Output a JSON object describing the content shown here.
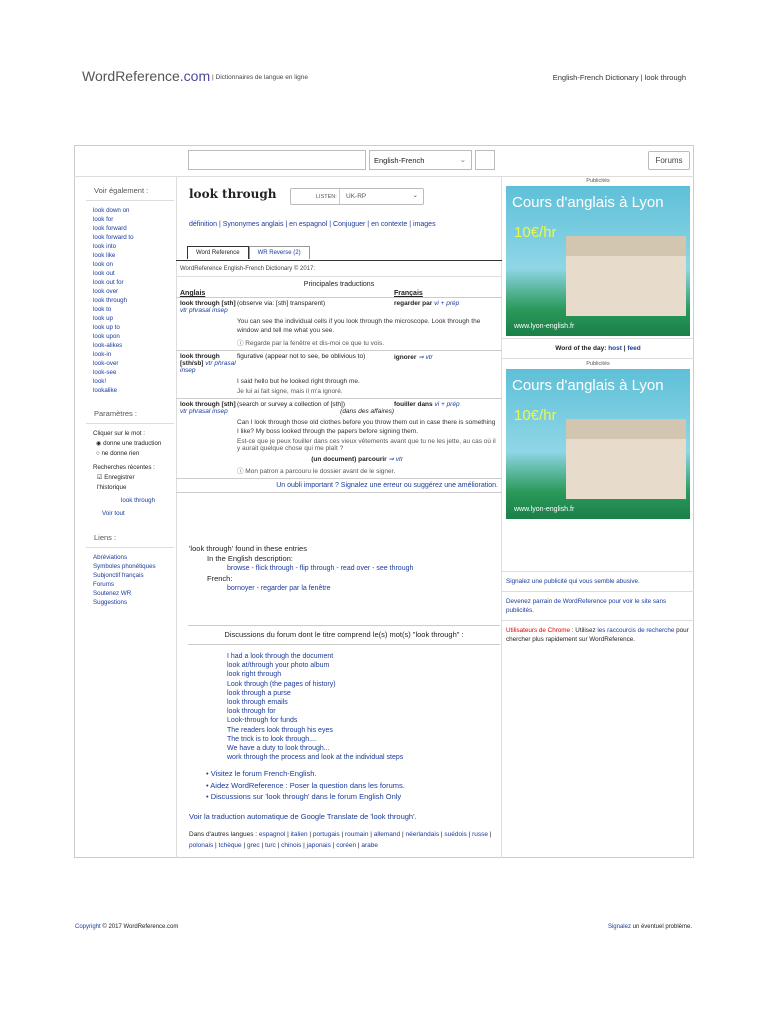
{
  "header": {
    "logo": "WordReference",
    "logo_com": ".com",
    "tagline": "| Dictionnaires de langue en ligne",
    "breadcrumb": "English-French Dictionary | look through"
  },
  "search": {
    "value": "",
    "lang": "English-French",
    "forums": "Forums"
  },
  "sidebar": {
    "see_also_title": "Voir également :",
    "see_also": [
      "look down on",
      "look for",
      "look forward",
      "look forward to",
      "look into",
      "look like",
      "look on",
      "look out",
      "look out for",
      "look over",
      "look through",
      "look to",
      "look up",
      "look up to",
      "look upon",
      "look-alikes",
      "look-in",
      "look-over",
      "look-see",
      "look!",
      "lookalike"
    ],
    "params_title": "Paramètres :",
    "click_label": "Cliquer sur le mot :",
    "opt1": "donne une traduction",
    "opt2": "ne donne rien",
    "recent_label": "Recherches récentes :",
    "save_history": "Enregistrer l'historique",
    "recent": "look through",
    "see_all": "Voir tout",
    "links_title": "Liens :",
    "links": [
      "Abréviations",
      "Symboles phonétiques",
      "Subjonctif français",
      "Forums",
      "Soutenez WR",
      "Suggestions"
    ]
  },
  "entry": {
    "title": "look through",
    "listen_label": "LISTEN:",
    "accent": "UK-RP",
    "links": [
      {
        "t": "définition"
      },
      {
        "t": "Synonymes anglais"
      },
      {
        "t": "en espagnol"
      },
      {
        "t": "Conjuguer"
      },
      {
        "t": "en contexte"
      },
      {
        "t": "images"
      }
    ],
    "tabs": [
      "Word Reference",
      "WR Reverse (2)"
    ],
    "dict_header": "WordReference English-French Dictionary © 2017:",
    "principal": "Principales traductions",
    "col_en": "Anglais",
    "col_fr": "Français",
    "rows": [
      {
        "term": "look through",
        "gram": "[sth]",
        "pos": "vtr phrasal insep",
        "sense": "(observe via: [sth] transparent)",
        "fr": "regarder par",
        "frpos": "vi + prép",
        "ex": "You can see the individual cells if you look through the microscope. Look through the window and tell me what you see.",
        "trans": "ⓘ Regarde par la fenêtre et dis-moi ce que tu vois."
      },
      {
        "term": "look through",
        "gram": "[sth/sb]",
        "pos": "vtr phrasal insep",
        "sense": "figurative (appear not to see, be oblivious to)",
        "fr": "ignorer",
        "frpos": "⇒ vtr",
        "ex": "I said hello but he looked right through me.",
        "trans": "Je lui ai fait signe, mais il m'a ignoré."
      },
      {
        "term": "look through",
        "gram": "[sth]",
        "pos": "vtr phrasal insep",
        "sense": "(search or survey a collection of [sth])",
        "sense2": "(dans des affaires)",
        "fr": "fouiller dans",
        "frpos": "vi + prép",
        "ex": "Can I look through those old clothes before you throw them out in case there is something I like? My boss looked through the papers before signing them.",
        "trans": "Est-ce que je peux fouiller dans ces vieux vêtements avant que tu ne les jette, au cas où il y aurait quelque chose qui me plaît ?",
        "alt": "(un document) parcourir",
        "altpos": "⇒ vtr",
        "trans2": "ⓘ Mon patron a parcouru le dossier avant de le signer."
      }
    ],
    "report": "Un oubli important ? Signalez une erreur ou suggérez une amélioration."
  },
  "found": {
    "title": "'look through' found in these entries",
    "en_label": "In the English description:",
    "en_links": "browse - flick through - flip through - read over - see through",
    "fr_label": "French:",
    "fr_links": "bornoyer - regarder par la fenêtre"
  },
  "forum": {
    "title": "Discussions du forum dont le titre comprend le(s) mot(s) \"look through\" :",
    "threads": [
      "I had a look through the document",
      "look at/through your photo album",
      "look right through",
      "Look through (the pages of history)",
      "look through a purse",
      "look through emails",
      "look through for",
      "Look-through for funds",
      "The readers look through his eyes",
      "The trick is to look through....",
      "We have a duty to look through...",
      "work through the process and look at the individual steps"
    ],
    "bullets": [
      "Visitez le forum French-English.",
      "Aidez WordReference : Poser la question dans les forums.",
      "Discussions sur 'look through' dans le forum English Only"
    ],
    "google": "Voir la traduction automatique de Google Translate de 'look through'.",
    "other_label": "Dans d'autres langues :",
    "other": [
      "espagnol",
      "italien",
      "portugais",
      "roumain",
      "allemand",
      "néerlandais",
      "suédois",
      "russe",
      "polonais",
      "tchèque",
      "grec",
      "turc",
      "chinois",
      "japonais",
      "coréen",
      "arabe"
    ]
  },
  "right": {
    "pub": "Publicités",
    "ad_title": "Cours d'anglais à Lyon",
    "ad_price": "10€/hr",
    "ad_url": "www.lyon-english.fr",
    "wod_label": "Word of the day:",
    "wod": "host",
    "feed": "feed",
    "report_ad": "Signalez une publicité qui vous semble abusive.",
    "sponsor": "Devenez parrain de WordReference pour voir le site sans publicités.",
    "chrome_label": "Utilisateurs de Chrome",
    "chrome_text": ": Utilisez",
    "chrome_link": "les raccourcis de recherche",
    "chrome_text2": "pour chercher plus rapidement sur WordReference."
  },
  "footer": {
    "copyright_link": "Copyright",
    "copyright": "© 2017 WordReference.com",
    "report_link": "Signalez",
    "report": "un éventuel problème."
  }
}
